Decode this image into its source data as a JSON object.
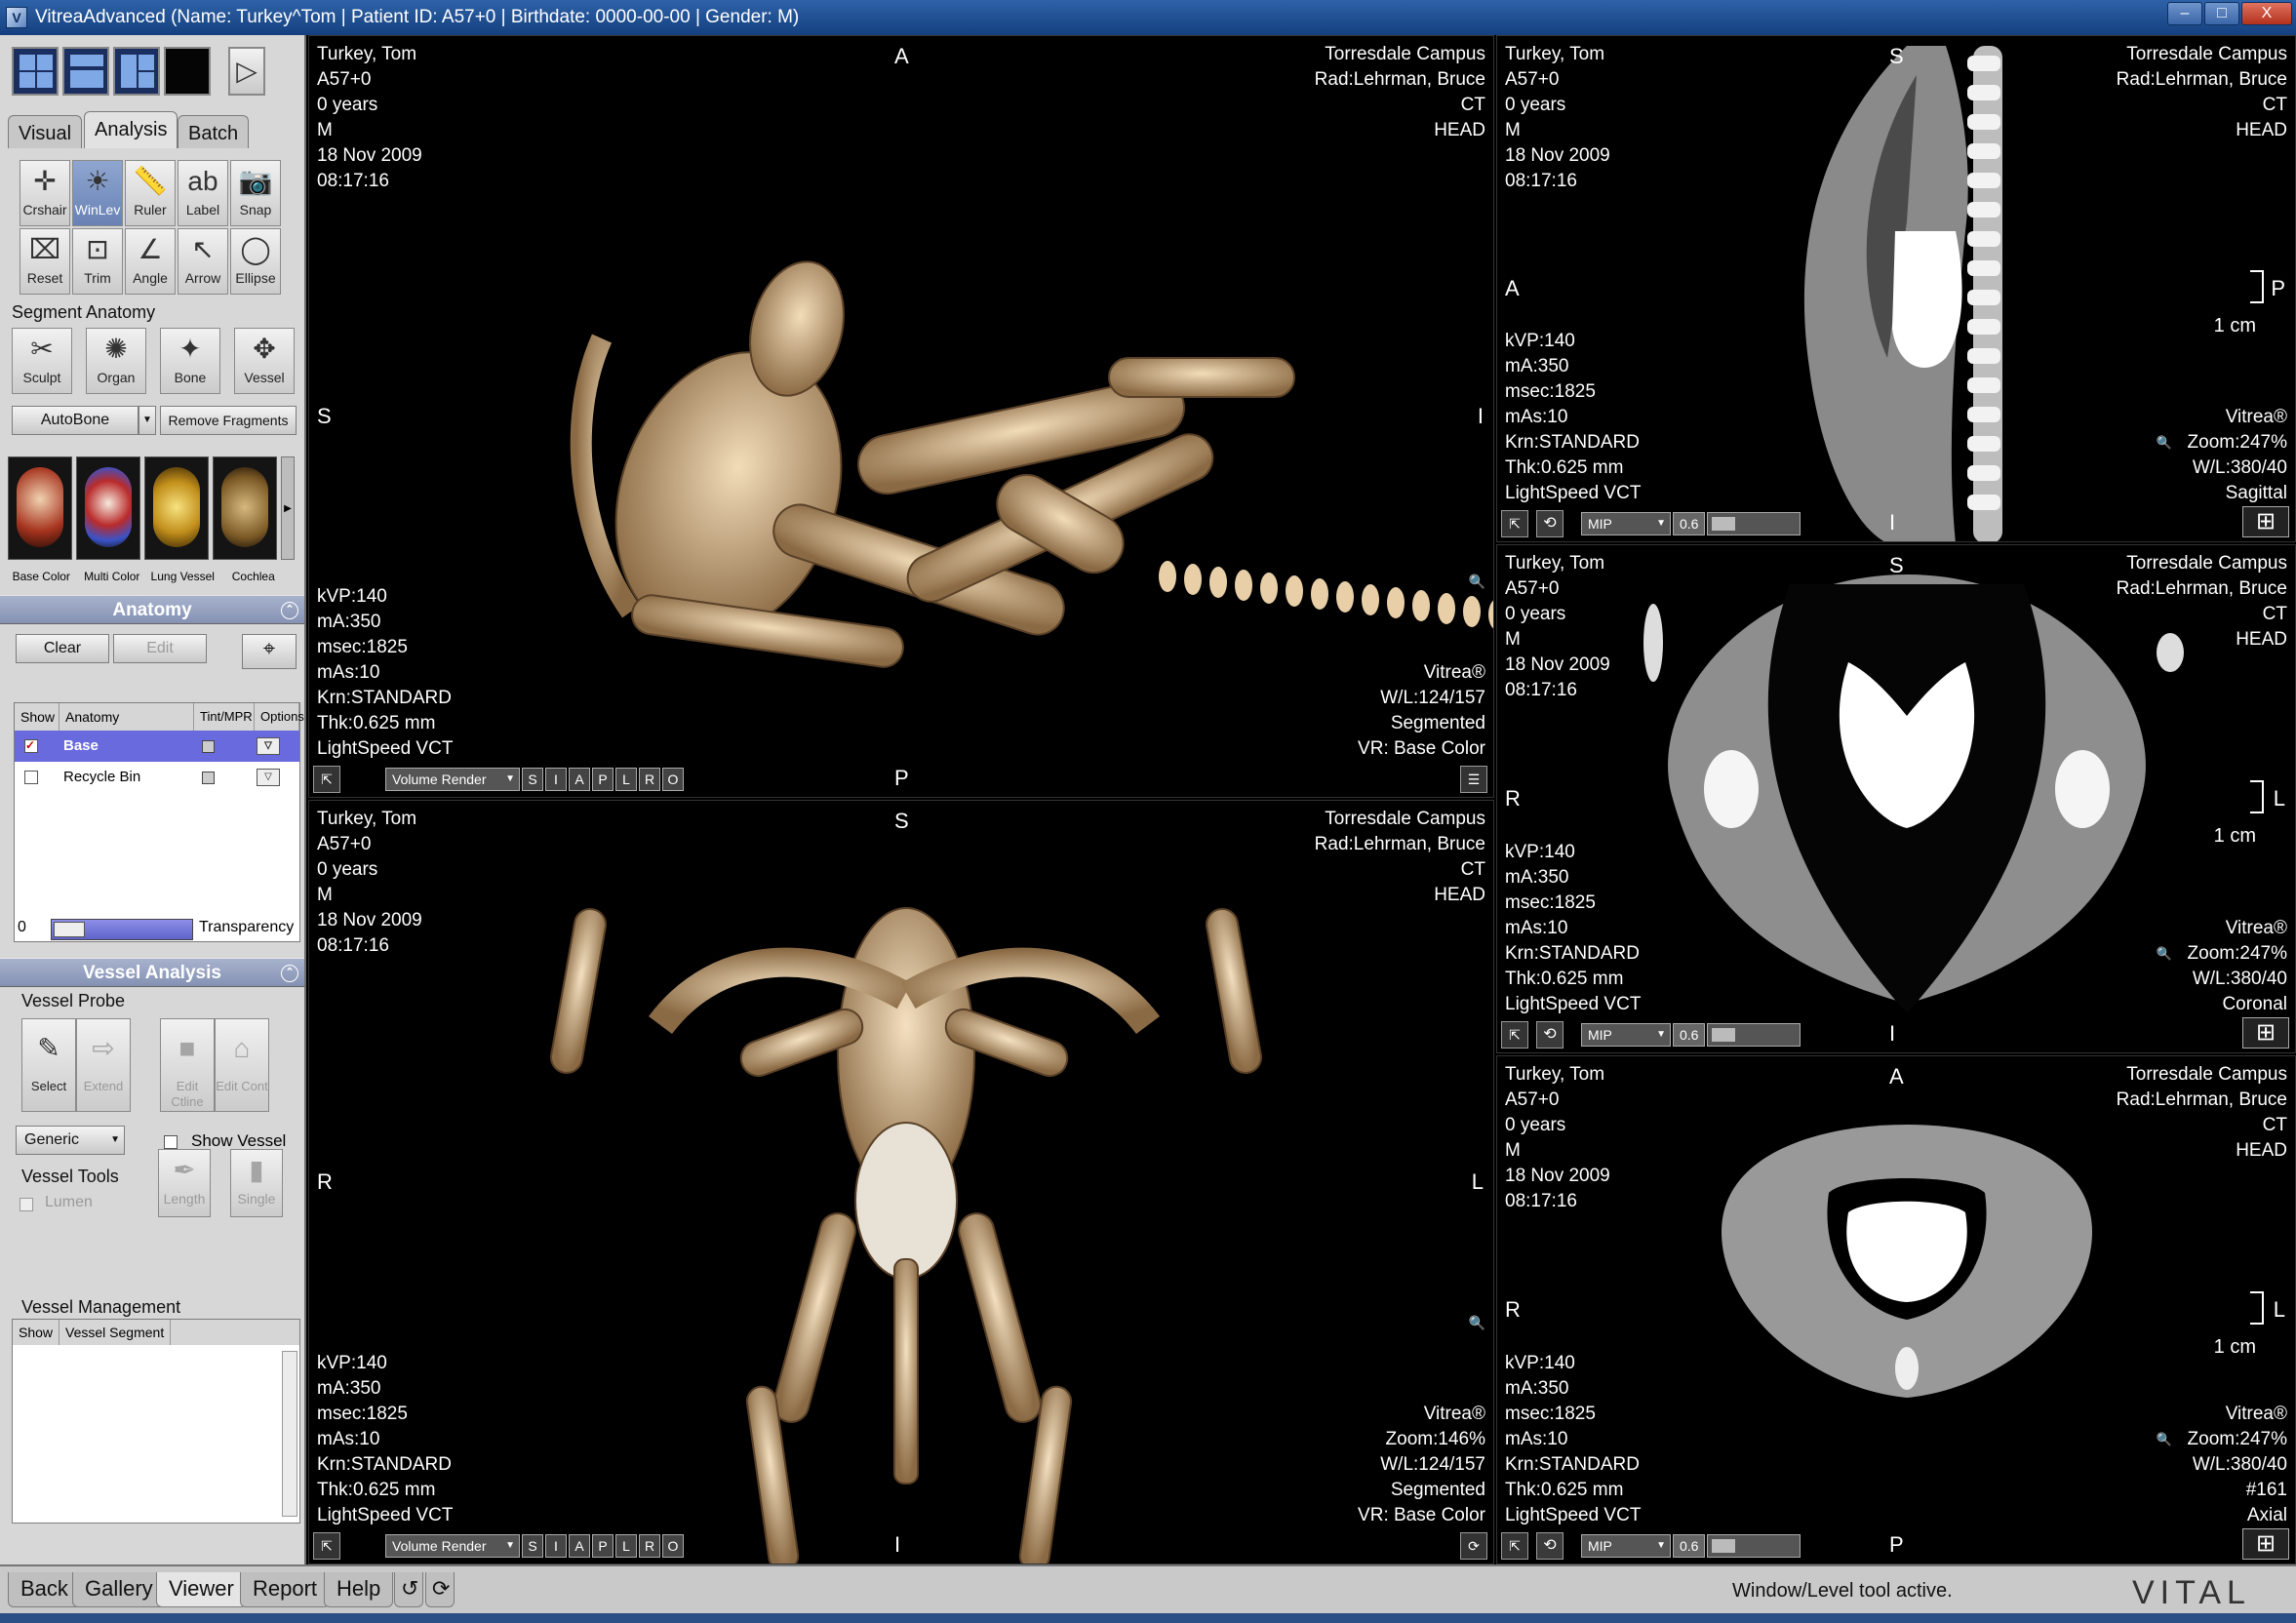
{
  "window": {
    "title": "VitreaAdvanced (Name: Turkey^Tom | Patient ID: A57+0 | Birthdate: 0000-00-00 | Gender: M)",
    "minimize": "–",
    "maximize": "□",
    "close": "X"
  },
  "left_tabs": [
    "Visual",
    "Analysis",
    "Batch"
  ],
  "tools_row1": [
    {
      "label": "Crshair",
      "icon": "crosshair-icon",
      "glyph": "✛"
    },
    {
      "label": "WinLev",
      "icon": "window-level-icon",
      "glyph": "☀"
    },
    {
      "label": "Ruler",
      "icon": "ruler-icon",
      "glyph": "📏"
    },
    {
      "label": "Label",
      "icon": "label-icon",
      "glyph": "ab"
    },
    {
      "label": "Snap",
      "icon": "camera-icon",
      "glyph": "📷"
    }
  ],
  "tools_row2": [
    {
      "label": "Reset",
      "icon": "reset-icon",
      "glyph": "⌧"
    },
    {
      "label": "Trim",
      "icon": "trim-icon",
      "glyph": "⊡"
    },
    {
      "label": "Angle",
      "icon": "angle-icon",
      "glyph": "∠"
    },
    {
      "label": "Arrow",
      "icon": "arrow-icon",
      "glyph": "↖"
    },
    {
      "label": "Ellipse",
      "icon": "ellipse-icon",
      "glyph": "◯"
    }
  ],
  "segment_anatomy": {
    "title": "Segment Anatomy",
    "tools": [
      {
        "label": "Sculpt",
        "icon": "sculpt-icon",
        "glyph": "✂"
      },
      {
        "label": "Organ",
        "icon": "organ-icon",
        "glyph": "✺"
      },
      {
        "label": "Bone",
        "icon": "bone-icon",
        "glyph": "✦"
      },
      {
        "label": "Vessel",
        "icon": "vessel-icon",
        "glyph": "✥"
      }
    ],
    "autobone": "AutoBone",
    "remove_fragments": "Remove Fragments"
  },
  "presets": [
    "Base Color",
    "Multi Color",
    "Lung Vessel",
    "Cochlea"
  ],
  "anatomy": {
    "title": "Anatomy",
    "clear": "Clear",
    "edit": "Edit",
    "columns": [
      "Show",
      "Anatomy",
      "Tint/MPR",
      "Options"
    ],
    "rows": [
      "Base",
      "Recycle Bin"
    ],
    "transparency_value": "0",
    "transparency_label": "Transparency"
  },
  "vessel_analysis": {
    "title": "Vessel Analysis",
    "probe_title": "Vessel Probe",
    "probe_tools": [
      "Select",
      "Extend",
      "Edit Ctline",
      "Edit Cont"
    ],
    "generic": "Generic",
    "show_vessel": "Show Vessel",
    "tools_title": "Vessel Tools",
    "lumen": "Lumen",
    "tools": [
      "Length",
      "Single"
    ],
    "management_title": "Vessel Management",
    "management_columns": [
      "Show",
      "Vessel Segment"
    ]
  },
  "bottom_tabs": [
    "Back",
    "Gallery",
    "Viewer",
    "Report",
    "Help"
  ],
  "status_text": "Window/Level tool active.",
  "brand": "VITAL",
  "patient": {
    "name": "Turkey, Tom",
    "id": "A57+0",
    "age": "0 years",
    "sex": "M",
    "date": "18 Nov 2009",
    "time": "08:17:16"
  },
  "site": {
    "campus": "Torresdale Campus",
    "radiologist": "Rad:Lehrman, Bruce",
    "modality": "CT",
    "body_part": "HEAD"
  },
  "acquisition": [
    "kVP:140",
    "mA:350",
    "msec:1825",
    "mAs:10",
    "Krn:STANDARD",
    "Thk:0.625 mm",
    "LightSpeed VCT"
  ],
  "viewports": [
    {
      "id": "vr-lateral",
      "orient": {
        "top": "A",
        "bottom": "P",
        "left": "S",
        "right": "I"
      },
      "br": [
        "Vitrea®",
        "W/L:124/157",
        "Segmented",
        "VR: Base Color"
      ],
      "mode": "Volume Render",
      "views": [
        "S",
        "I",
        "A",
        "P",
        "L",
        "R",
        "O"
      ]
    },
    {
      "id": "vr-frontal",
      "orient": {
        "top": "S",
        "bottom": "I",
        "left": "R",
        "right": "L"
      },
      "br": [
        "Vitrea®",
        "Zoom:146%",
        "W/L:124/157",
        "Segmented",
        "VR: Base Color"
      ],
      "mode": "Volume Render",
      "views": [
        "S",
        "I",
        "A",
        "P",
        "L",
        "R",
        "O"
      ]
    },
    {
      "id": "mpr-sagittal",
      "orient": {
        "top": "S",
        "bottom": "I",
        "left": "A",
        "right": "P"
      },
      "scale": "1 cm",
      "br": [
        "Vitrea®",
        "Zoom:247%",
        "W/L:380/40",
        "Sagittal"
      ],
      "mode": "MIP",
      "thick": "0.6"
    },
    {
      "id": "mpr-coronal",
      "orient": {
        "top": "S",
        "bottom": "I",
        "left": "R",
        "right": "L"
      },
      "scale": "1 cm",
      "br": [
        "Vitrea®",
        "Zoom:247%",
        "W/L:380/40",
        "Coronal"
      ],
      "mode": "MIP",
      "thick": "0.6"
    },
    {
      "id": "mpr-axial",
      "orient": {
        "top": "A",
        "bottom": "P",
        "left": "R",
        "right": "L"
      },
      "scale": "1 cm",
      "br": [
        "Vitrea®",
        "Zoom:247%",
        "W/L:380/40",
        "#161",
        "Axial"
      ],
      "mode": "MIP",
      "thick": "0.6"
    }
  ],
  "colors": {
    "bone": "#d9b98e",
    "panel": "#d7d7d7",
    "selection": "#6a6adf",
    "title_bar": "#1f4f93"
  }
}
